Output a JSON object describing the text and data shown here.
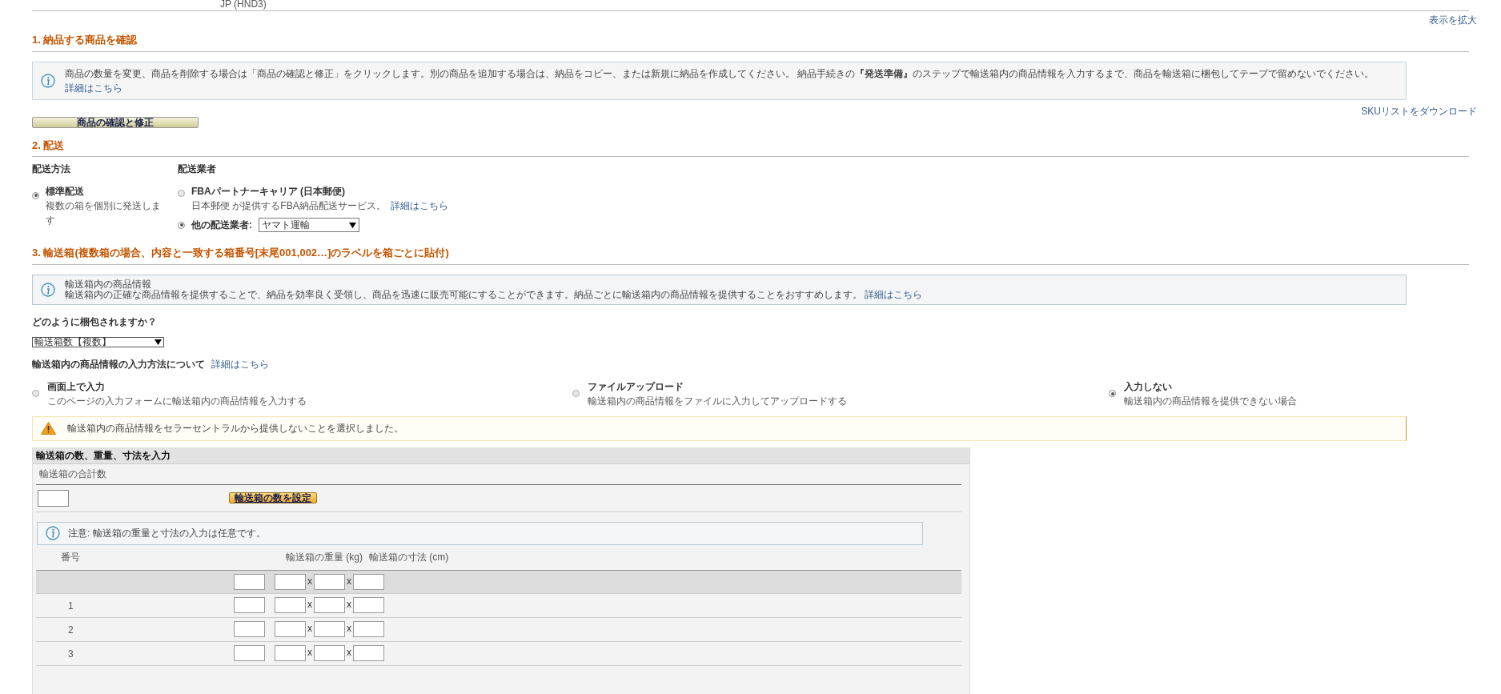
{
  "top_text": "JP (HND3)",
  "zoom_link": "表示を拡大",
  "section1": {
    "heading": "1. 納品する商品を確認",
    "info": "商品の数量を変更、商品を削除する場合は「商品の確認と修正」をクリックします。別の商品を追加する場合は、納品をコピー、または新規に納品を作成してください。 納品手続きの**『発送準備』**のステップで輸送箱内の商品情報を入力するまで、商品を輸送箱に梱包してテープで留めないでください。",
    "info_link": "詳細はこちら",
    "download_link": "SKUリストをダウンロード",
    "button": "商品の確認と修正"
  },
  "section2": {
    "heading": "2. 配送",
    "method_label": "配送方法",
    "carrier_label": "配送業者",
    "methods": [
      {
        "title": "標準配送",
        "description": "複数の箱を個別に発送します",
        "selected": true
      }
    ],
    "carriers": [
      {
        "kind": "partner",
        "title": "FBAパートナーキャリア (日本郵便)",
        "description": "日本郵便 が提供するFBA納品配送サービス。",
        "link": "詳細はこちら",
        "selected": false
      },
      {
        "kind": "other",
        "title": "他の配送業者:",
        "value": "ヤマト運輸",
        "selected": true
      }
    ]
  },
  "section3": {
    "heading": "3. 輸送箱(複数箱の場合、内容と一致する箱番号[末尾001,002…]のラベルを箱ごとに貼付)",
    "info_title": "輸送箱内の商品情報",
    "info": "輸送箱内の正確な商品情報を提供することで、納品を効率良く受領し、商品を迅速に販売可能にすることができます。納品ごとに輸送箱内の商品情報を提供することをおすすめします。",
    "info_link": "詳細はこちら",
    "packing_question": "どのように梱包されますか？",
    "packing_value": "輸送箱数【複数】",
    "input_method_label": "輸送箱内の商品情報の入力方法について",
    "input_method_link": "詳細はこちら",
    "input_options": [
      {
        "title": "画面上で入力",
        "description": "このページの入力フォームに輸送箱内の商品情報を入力する",
        "selected": false
      },
      {
        "title": "ファイルアップロード",
        "description": "輸送箱内の商品情報をファイルに入力してアップロードする",
        "selected": false
      },
      {
        "title": "入力しない",
        "description": "輸送箱内の商品情報を提供できない場合",
        "selected": true
      }
    ],
    "warning": "輸送箱内の商品情報をセラーセントラルから提供しないことを選択しました。"
  },
  "box_panel": {
    "title": "輸送箱の数、重量、寸法を入力",
    "total_label": "輸送箱の合計数",
    "set_button": "輸送箱の数を設定",
    "note": "注意: 輸送箱の重量と寸法の入力は任意です。",
    "columns": [
      "番号",
      "輸送箱の重量 (kg)",
      "輸送箱の寸法 (cm)"
    ],
    "rows": [
      {
        "separators": [
          "x",
          "x"
        ]
      },
      {
        "number": "1",
        "separators": [
          "x",
          "x"
        ]
      },
      {
        "number": "2",
        "separators": [
          "x",
          "x"
        ]
      },
      {
        "number": "3",
        "separators": [
          "x",
          "x"
        ]
      }
    ]
  }
}
